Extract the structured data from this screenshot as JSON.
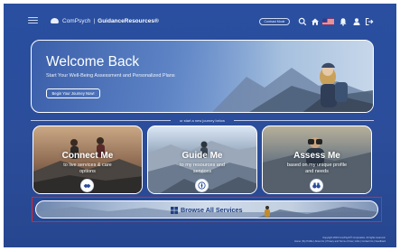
{
  "header": {
    "brand_name": "ComPsych",
    "brand_separator": "|",
    "brand_product": "GuidanceResources®",
    "contrast_button": "Contrast Mode",
    "icons": [
      "hamburger-icon",
      "search-icon",
      "home-icon",
      "us-flag-icon",
      "bell-icon",
      "person-icon",
      "sign-out-icon"
    ]
  },
  "welcome": {
    "title": "Welcome Back",
    "subtitle": "Start Your Well-Being Assessment and Personalized Plans",
    "button": "Begin Your Journey Now!"
  },
  "divider_text": "or start a new journey below",
  "cards": [
    {
      "title": "Connect Me",
      "subtitle": "to live services & care options",
      "icon": "handshake-icon"
    },
    {
      "title": "Guide Me",
      "subtitle": "to my resources and services",
      "icon": "compass-icon"
    },
    {
      "title": "Assess Me",
      "subtitle": "based on my unique profile and needs",
      "icon": "binoculars-icon"
    }
  ],
  "browse": {
    "label": "Browse All Services",
    "icon": "grid-icon"
  },
  "footer": {
    "line1": "Copyright 2023 ComPsych® Corporation. All rights reserved.",
    "line2": "Home | My Profile | About Us | Privacy and Terms of Use | Jobs | Contact Us | Feedback"
  },
  "colors": {
    "background": "#2b4d9a",
    "highlight_outline": "#e0242b",
    "browse_text": "#1e3d84"
  }
}
